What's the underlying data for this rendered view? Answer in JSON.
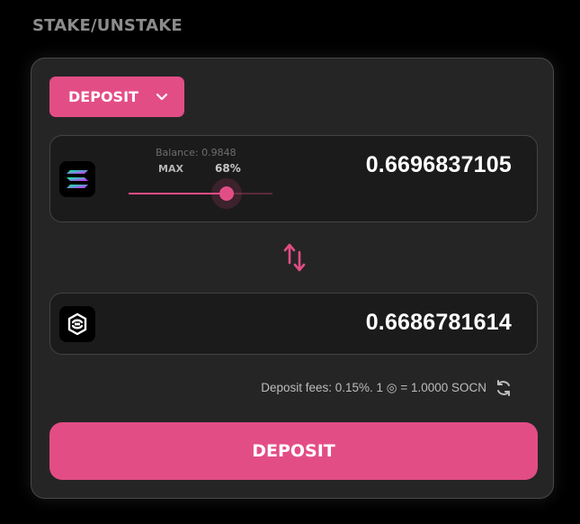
{
  "header": {
    "title": "STAKE/UNSTAKE"
  },
  "mode_dropdown": {
    "label": "DEPOSIT",
    "icon": "chevron-down-icon"
  },
  "from_token": {
    "icon": "solana-logo-icon",
    "balance_text": "Balance: 0.9848",
    "max_label": "MAX",
    "percent_label": "68%",
    "slider_value": 0.68,
    "amount": "0.6696837105"
  },
  "swap": {
    "icon": "swap-arrows-icon"
  },
  "to_token": {
    "icon": "socean-logo-icon",
    "amount": "0.6686781614"
  },
  "fees": {
    "text": "Deposit fees: 0.15%. 1 ◎ = 1.0000 SOCN",
    "refresh_icon": "refresh-icon"
  },
  "submit": {
    "label": "DEPOSIT"
  },
  "colors": {
    "accent": "#e34d86",
    "background": "#000000",
    "panel": "#262525",
    "input": "#1c1b1b"
  }
}
